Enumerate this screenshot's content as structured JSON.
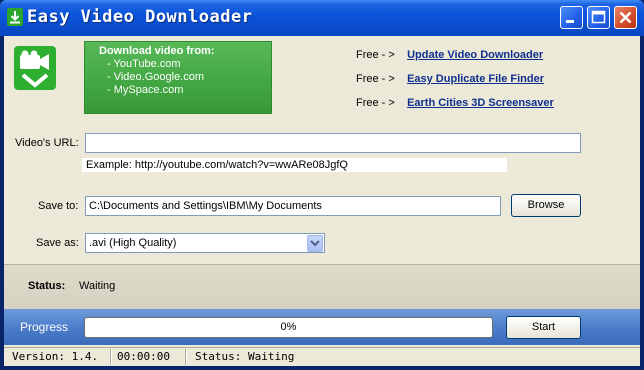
{
  "titlebar": {
    "title": "Easy Video Downloader",
    "icon": "download-arrow-icon",
    "buttons": [
      "minimize-icon",
      "maximize-icon",
      "close-icon"
    ]
  },
  "promo": {
    "heading": "Download video from:",
    "sites": [
      "- YouTube.com",
      "- Video.Google.com",
      "- MySpace.com"
    ]
  },
  "links": [
    {
      "prefix": "Free - >",
      "label": "Update Video Downloader"
    },
    {
      "prefix": "Free - >",
      "label": "Easy Duplicate File Finder"
    },
    {
      "prefix": "Free - >",
      "label": "Earth Cities 3D Screensaver"
    }
  ],
  "form": {
    "url_label": "Video's URL:",
    "url_value": "",
    "example": "Example: http://youtube.com/watch?v=wwARe08JgfQ",
    "save_to_label": "Save to:",
    "save_to_value": "C:\\Documents and Settings\\IBM\\My Documents",
    "browse_label": "Browse",
    "save_as_label": "Save as:",
    "save_as_value": ".avi (High Quality)"
  },
  "status": {
    "label": "Status:",
    "value": "Waiting"
  },
  "progress": {
    "label": "Progress",
    "percent_text": "0%",
    "fraction": 0,
    "start_label": "Start"
  },
  "statusbar": {
    "version": "Version: 1.4.",
    "time": "00:00:00",
    "status": "Status: Waiting"
  },
  "colors": {
    "titlebar": "#0A54DC",
    "promo_green": "#43A843",
    "link": "#0E2F8E",
    "progress_panel": "#4C7ECB"
  }
}
